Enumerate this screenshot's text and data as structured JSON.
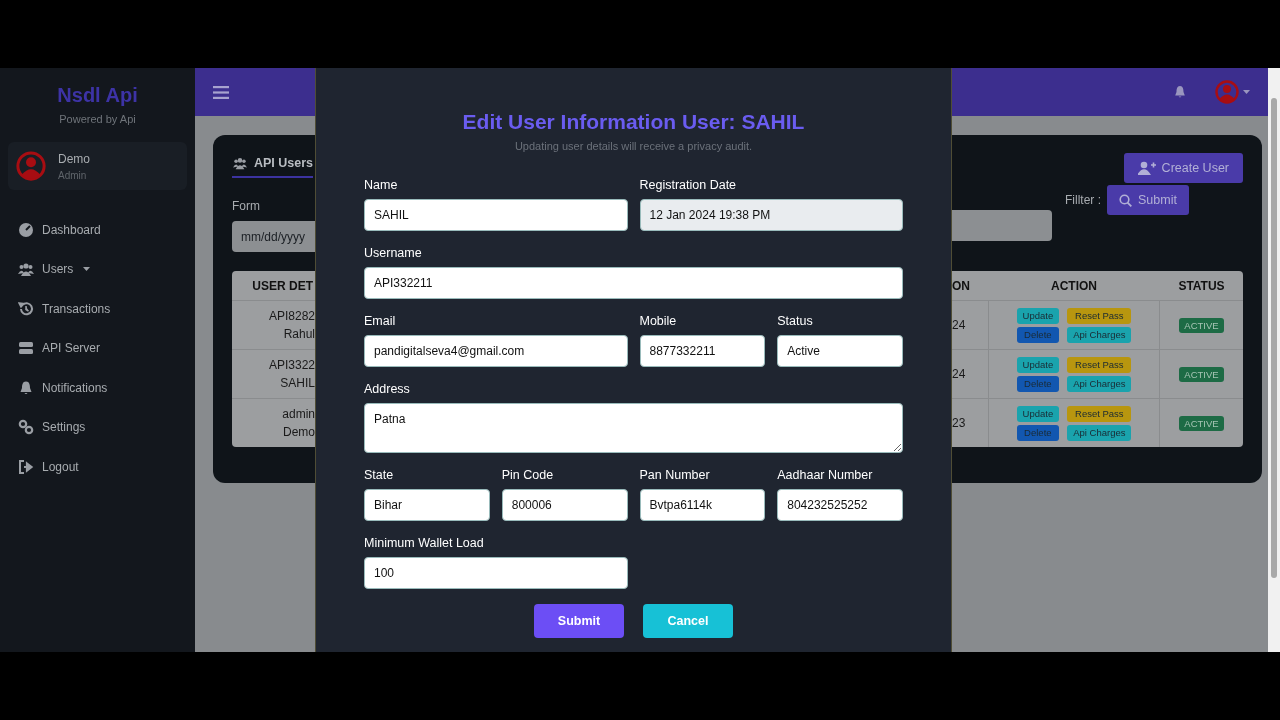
{
  "sidebar": {
    "brand": "Nsdl Api",
    "tagline": "Powered by Api",
    "user": {
      "name": "Demo",
      "role": "Admin"
    },
    "items": [
      {
        "label": "Dashboard",
        "dropdown": false
      },
      {
        "label": "Users",
        "dropdown": true
      },
      {
        "label": "Transactions",
        "dropdown": false
      },
      {
        "label": "API Server",
        "dropdown": false
      },
      {
        "label": "Notifications",
        "dropdown": false
      },
      {
        "label": "Settings",
        "dropdown": false
      },
      {
        "label": "Logout",
        "dropdown": false
      }
    ]
  },
  "page": {
    "tab": "API Users",
    "create_button": "Create User",
    "from_label": "Form",
    "date_placeholder": "mm/dd/yyyy",
    "filter_label": "Fillter :",
    "filter_button": "Submit"
  },
  "table": {
    "columns": [
      "USER DET",
      "ON",
      "ACTION",
      "STATUS"
    ],
    "rows": [
      {
        "user_details": [
          "API8282",
          "Rahul"
        ],
        "column_2": "24",
        "actions": [
          {
            "label": "Update",
            "color": "#1aa3ad"
          },
          {
            "label": "Reset Pass",
            "color": "#b8960f"
          },
          {
            "label": "Delete",
            "color": "#1257b0"
          },
          {
            "label": "Api Charges",
            "color": "#1aa3ad"
          }
        ],
        "status": "ACTIVE"
      },
      {
        "user_details": [
          "API3322",
          "SAHIL"
        ],
        "column_2": "24",
        "actions": [
          {
            "label": "Update",
            "color": "#1aa3ad"
          },
          {
            "label": "Reset Pass",
            "color": "#b8960f"
          },
          {
            "label": "Delete",
            "color": "#1257b0"
          },
          {
            "label": "Api Charges",
            "color": "#1aa3ad"
          }
        ],
        "status": "ACTIVE"
      },
      {
        "user_details": [
          "admin",
          "Demo"
        ],
        "column_2": "23",
        "actions": [
          {
            "label": "Update",
            "color": "#1aa3ad"
          },
          {
            "label": "Reset Pass",
            "color": "#b8960f"
          },
          {
            "label": "Delete",
            "color": "#1257b0"
          },
          {
            "label": "Api Charges",
            "color": "#1aa3ad"
          }
        ],
        "status": "ACTIVE"
      }
    ]
  },
  "modal": {
    "title": "Edit User Information User: SAHIL",
    "subtitle": "Updating user details will receive a privacy audit.",
    "fields": [
      {
        "label": "Name",
        "value": "SAHIL",
        "kind": "input",
        "disabled": false
      },
      {
        "label": "Registration Date",
        "value": "12 Jan 2024 19:38 PM",
        "kind": "input",
        "disabled": true
      },
      {
        "label": "Username",
        "value": "API332211",
        "kind": "input",
        "disabled": false
      },
      {
        "label": "Email",
        "value": "pandigitalseva4@gmail.com",
        "kind": "input",
        "disabled": false
      },
      {
        "label": "Mobile",
        "value": "8877332211",
        "kind": "input",
        "disabled": false
      },
      {
        "label": "Status",
        "value": "Active",
        "kind": "input",
        "disabled": false
      },
      {
        "label": "Address",
        "value": "Patna",
        "kind": "textarea",
        "disabled": false
      },
      {
        "label": "State",
        "value": "Bihar",
        "kind": "input",
        "disabled": false
      },
      {
        "label": "Pin Code",
        "value": "800006",
        "kind": "input",
        "disabled": false
      },
      {
        "label": "Pan Number",
        "value": "Bvtpa6114k",
        "kind": "input",
        "disabled": false
      },
      {
        "label": "Aadhaar Number",
        "value": "804232525252",
        "kind": "input",
        "disabled": false
      },
      {
        "label": "Minimum Wallet Load",
        "value": "100",
        "kind": "input",
        "disabled": false
      }
    ],
    "buttons": [
      {
        "label": "Submit",
        "kind": "primary"
      },
      {
        "label": "Cancel",
        "kind": "secondary"
      }
    ]
  }
}
